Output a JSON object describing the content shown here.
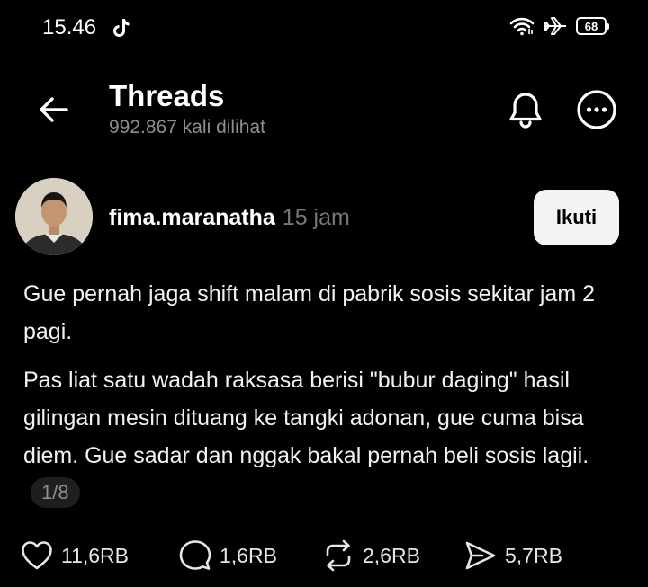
{
  "status_bar": {
    "time": "15.46",
    "battery": "68",
    "icons": [
      "tiktok-icon",
      "wifi-icon",
      "airplane-icon",
      "battery-icon"
    ]
  },
  "header": {
    "title": "Threads",
    "subtitle": "992.867 kali dilihat",
    "icons": [
      "back-arrow-icon",
      "bell-icon",
      "more-icon"
    ]
  },
  "post": {
    "username": "fima.maranatha",
    "time": "15 jam",
    "follow_label": "Ikuti",
    "paragraph_1": "Gue pernah jaga shift malam di pabrik sosis sekitar jam 2 pagi.",
    "paragraph_2": "Pas liat satu wadah raksasa berisi \"bubur daging\" hasil gilingan mesin dituang ke tangki adonan, gue cuma bisa diem. Gue sadar dan nggak bakal pernah beli sosis lagii.",
    "page_indicator": "1/8"
  },
  "actions": {
    "likes": "11,6RB",
    "comments": "1,6RB",
    "reposts": "2,6RB",
    "shares": "5,7RB"
  },
  "colors": {
    "background": "#000000",
    "text": "#ffffff",
    "muted": "#8e8e8e",
    "follow_button_bg": "#f3f3f3"
  }
}
